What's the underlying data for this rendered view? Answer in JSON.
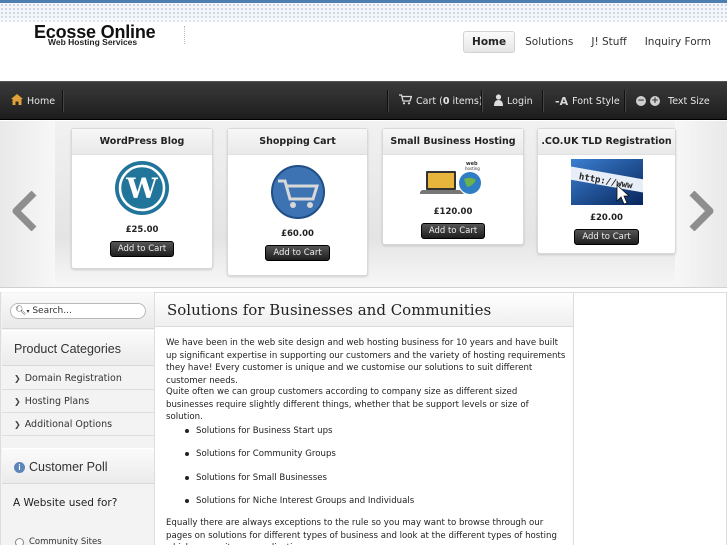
{
  "header": {
    "logo_title": "Ecosse Online",
    "logo_subtitle": "Web Hosting Services",
    "nav": [
      "Home",
      "Solutions",
      "J! Stuff",
      "Inquiry Form"
    ],
    "nav_active": "Home"
  },
  "toolbar": {
    "home": "Home",
    "cart_prefix": "Cart (",
    "cart_count": "0",
    "cart_suffix": " items)",
    "login": "Login",
    "font_style": "Font Style",
    "text_size": "Text Size"
  },
  "carousel": {
    "products": [
      {
        "name": "WordPress Blog",
        "price": "£25.00",
        "button": "Add to Cart",
        "image": "wordpress-logo"
      },
      {
        "name": "Shopping Cart",
        "price": "£60.00",
        "button": "Add to Cart",
        "image": "shopping-cart-globe"
      },
      {
        "name": "Small Business Hosting",
        "price": "£120.00",
        "button": "Add to Cart",
        "image": "web-hosting-laptop"
      },
      {
        "name": ".CO.UK TLD Registration",
        "price": "£20.00",
        "button": "Add to Cart",
        "image": "http-address-cursor"
      }
    ]
  },
  "sidebar": {
    "search_placeholder": "Search...",
    "categories_title": "Product Categories",
    "categories": [
      "Domain Registration",
      "Hosting Plans",
      "Additional Options"
    ],
    "poll_title": "Customer Poll",
    "poll_question": "A Website used for?",
    "poll_option": "Community Sites"
  },
  "main": {
    "title": "Solutions for Businesses and Communities",
    "para1": "We have been in the web site design and web hosting business for 10 years and have built up significant expertise in supporting our customers and the variety of hosting requirements they have! Every customer is unique and we customise our solutions to suit different customer needs.",
    "para2": "Quite often we can group customers according to company size as different sized businesses require slightly different things, whether that be support levels or size of solution.",
    "bullets": [
      "Solutions for Business Start ups",
      "Solutions for Community Groups",
      "Solutions for Small Businesses",
      "Solutions for Niche Interest Groups and Individuals"
    ],
    "para3": "Equally there are always exceptions to the rule so you may want to browse through our pages on solutions for different types of business and look at the different types of hosting which may suit your application."
  },
  "colors": {
    "toolbar_dark": "#1d1d1d",
    "accent_blue": "#4f7fb0"
  }
}
